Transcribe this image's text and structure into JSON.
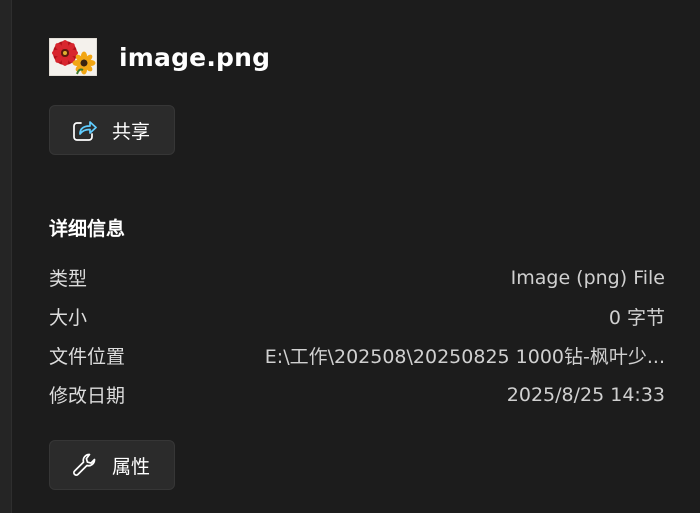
{
  "file": {
    "name": "image.png",
    "thumbnail": "flower-thumbnail-icon"
  },
  "actions": {
    "share_label": "共享",
    "share_icon": "share-icon",
    "properties_label": "属性",
    "properties_icon": "wrench-icon"
  },
  "details": {
    "title": "详细信息",
    "rows": [
      {
        "key": "类型",
        "value": "Image (png) File"
      },
      {
        "key": "大小",
        "value": "0 字节"
      },
      {
        "key": "文件位置",
        "value": "E:\\工作\\202508\\20250825 1000钻-枫叶少..."
      },
      {
        "key": "修改日期",
        "value": "2025/8/25 14:33"
      }
    ]
  },
  "colors": {
    "background": "#1c1c1c",
    "button_bg": "#2b2b2b",
    "accent": "#60cdff"
  }
}
